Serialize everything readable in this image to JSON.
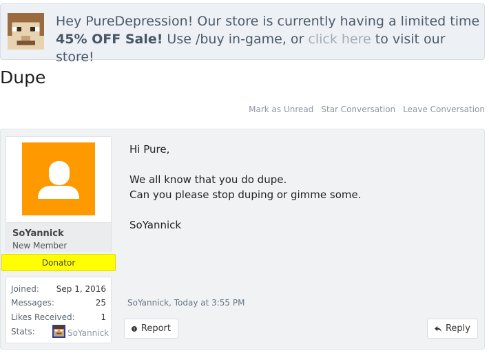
{
  "notice": {
    "line1": "Hey PureDepression! Our store is currently having a limited time",
    "sale": "45% OFF Sale!",
    "middle": " Use /buy in-game, or ",
    "link": "click here",
    "end": " to visit our store!"
  },
  "page": {
    "title": "Dupe"
  },
  "actions": {
    "mark_unread": "Mark as Unread",
    "star": "Star Conversation",
    "leave": "Leave Conversation"
  },
  "user": {
    "name": "SoYannick",
    "title": "New Member",
    "ribbon": "Donator",
    "stats": {
      "joined_label": "Joined:",
      "joined": "Sep 1, 2016",
      "messages_label": "Messages:",
      "messages": "25",
      "likes_label": "Likes Received:",
      "likes": "1",
      "stats_label": "Stats:",
      "stats_name": "SoYannick"
    }
  },
  "message": {
    "greeting": "Hi Pure,",
    "line1": "We all know that you do dupe.",
    "line2": "Can you please stop duping or gimme some.",
    "signoff": "SoYannick",
    "meta": "SoYannick, Today at 3:55 PM",
    "report_label": "Report",
    "reply_label": "Reply"
  },
  "colors": {
    "avatar_bg": "#ff9900",
    "ribbon_bg": "#ffff00",
    "notice_bg": "#edf0f4"
  }
}
